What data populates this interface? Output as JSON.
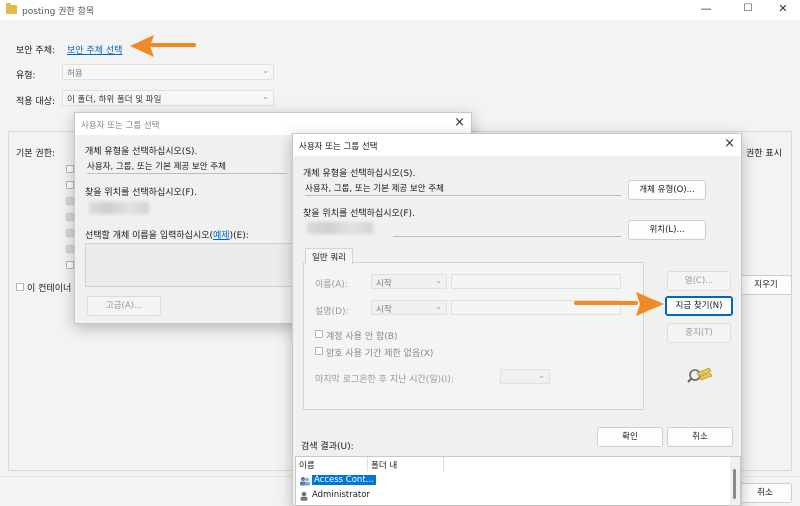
{
  "window": {
    "title": "posting 권한 항목",
    "minimize": "—",
    "maximize": "☐",
    "close": "✕"
  },
  "main": {
    "principal_label": "보안 주체:",
    "principal_link": "보안 주체 선택",
    "type_label": "유형:",
    "type_value": "허용",
    "applies_label": "적용 대상:",
    "applies_value": "이 폴더, 하위 폴더 및 파일",
    "basic_perm_label": "기본 권한:",
    "show_adv": "권한 표시",
    "container_cb": "이 컨테이너",
    "clear_all": "지우기",
    "cancel": "취소"
  },
  "back_dialog": {
    "title": "사용자 또는 그룹 선택",
    "object_type_label": "개체 유형을 선택하십시오(S).",
    "object_type_value": "사용자, 그룹, 또는 기본 제공 보안 주체",
    "location_label": "찾을 위치를 선택하십시오(F).",
    "enter_prefix": "선택할 개체 이름을 입력하십시오(",
    "enter_link": "예제",
    "enter_suffix": ")(E):",
    "advanced_btn": "고급(A)..."
  },
  "front_dialog": {
    "title": "사용자 또는 그룹 선택",
    "object_type_label": "개체 유형을 선택하십시오(S).",
    "object_type_value": "사용자, 그룹, 또는 기본 제공 보안 주체",
    "object_types_btn": "개체 유형(O)...",
    "location_label": "찾을 위치를 선택하십시오(F).",
    "locations_btn": "위치(L)...",
    "tab_common": "일반 쿼리",
    "name_label": "이름(A):",
    "name_op": "시작",
    "desc_label": "설명(D):",
    "desc_op": "시작",
    "disabled_cb": "계정 사용 안 함(B)",
    "nonexpiring_cb": "암호 사용 기간 제한 없음(X)",
    "days_label": "마지막 로그온한 후 지난 시간(일)(I):",
    "columns_btn": "열(C)...",
    "find_now_btn": "지금 찾기(N)",
    "stop_btn": "중지(T)",
    "ok_btn": "확인",
    "cancel_btn": "취소",
    "results_label": "검색 결과(U):",
    "col_name": "이름",
    "col_folder": "폴더 내",
    "results": [
      "Access Cont...",
      "Administrator"
    ]
  },
  "colors": {
    "accent": "#0067c0",
    "arrow": "#f08a24",
    "link": "#0066cc"
  }
}
